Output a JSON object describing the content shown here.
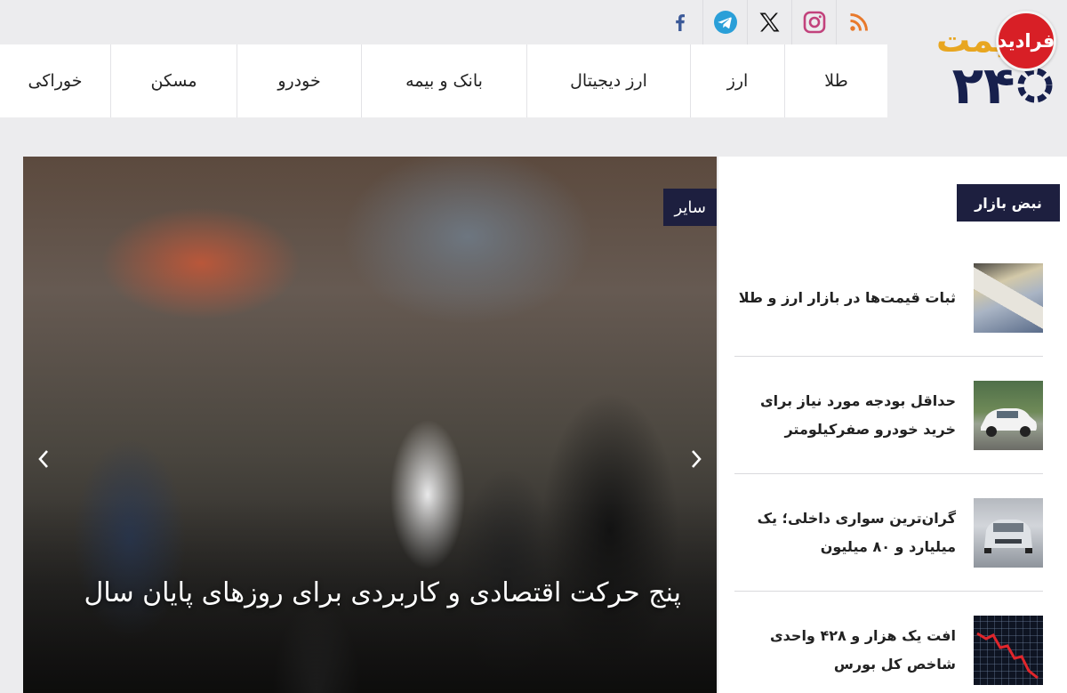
{
  "site": {
    "logo_wordmark": "قیمت",
    "logo_digits": "۲۴",
    "badge_text": "فرادید"
  },
  "colors": {
    "navy": "#1d1f3f",
    "brand_yellow": "#e8a620",
    "brand_navy": "#17204d",
    "badge_red": "#d81f26",
    "page_bg": "#ececee"
  },
  "social": [
    {
      "name": "rss-icon",
      "color": "#e8792b"
    },
    {
      "name": "instagram-icon",
      "color": "#c2427c"
    },
    {
      "name": "x-icon",
      "color": "#111111"
    },
    {
      "name": "telegram-icon",
      "color": "#2a9fd8"
    },
    {
      "name": "facebook-icon",
      "color": "#3b5998"
    }
  ],
  "nav": {
    "items": [
      {
        "label": "طلا"
      },
      {
        "label": "ارز"
      },
      {
        "label": "ارز دیجیتال"
      },
      {
        "label": "بانک و بیمه"
      },
      {
        "label": "خودرو"
      },
      {
        "label": "مسکن"
      },
      {
        "label": "خوراکی"
      }
    ]
  },
  "hero": {
    "category": "سایر",
    "title": "پنج حرکت اقتصادی و کاربردی برای روزهای پایان سال",
    "prev_icon": "chevron-left-icon",
    "next_icon": "chevron-right-icon"
  },
  "sidebar": {
    "heading": "نبض بازار",
    "items": [
      {
        "title": "ثبات قیمت‌ها در بازار ارز و طلا",
        "thumb": "cash-photo"
      },
      {
        "title": "حداقل بودجه مورد نیاز برای خرید خودرو صفرکیلومتر",
        "thumb": "car-photo"
      },
      {
        "title": "گران‌ترین سواری داخلی؛ یک میلیارد و ۸۰ میلیون",
        "thumb": "car-factory-photo"
      },
      {
        "title": "افت یک هزار و ۴۲۸ واحدی شاخص کل بورس",
        "thumb": "stock-chart-photo"
      }
    ]
  }
}
